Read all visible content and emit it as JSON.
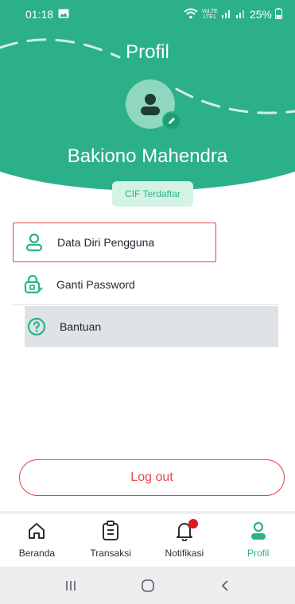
{
  "status_bar": {
    "time": "01:18",
    "battery": "25%",
    "net_label_top": "VoLTE",
    "net_label_bottom": "LTE1"
  },
  "header": {
    "title": "Profil",
    "user_name": "Bakiono Mahendra",
    "cif_badge": "CIF Terdaftar"
  },
  "menu": {
    "items": [
      {
        "label": "Data Diri Pengguna",
        "icon": "person-icon"
      },
      {
        "label": "Ganti Password",
        "icon": "lock-edit-icon"
      },
      {
        "label": "Bantuan",
        "icon": "help-icon"
      }
    ]
  },
  "logout": {
    "label": "Log out"
  },
  "bottom_nav": {
    "items": [
      {
        "label": "Beranda",
        "icon": "home-icon"
      },
      {
        "label": "Transaksi",
        "icon": "receipt-icon"
      },
      {
        "label": "Notifikasi",
        "icon": "bell-icon"
      },
      {
        "label": "Profil",
        "icon": "profile-icon"
      }
    ],
    "active": "Profil"
  },
  "colors": {
    "primary": "#2bb08a",
    "danger": "#e0484f",
    "notif": "#e0161e"
  }
}
